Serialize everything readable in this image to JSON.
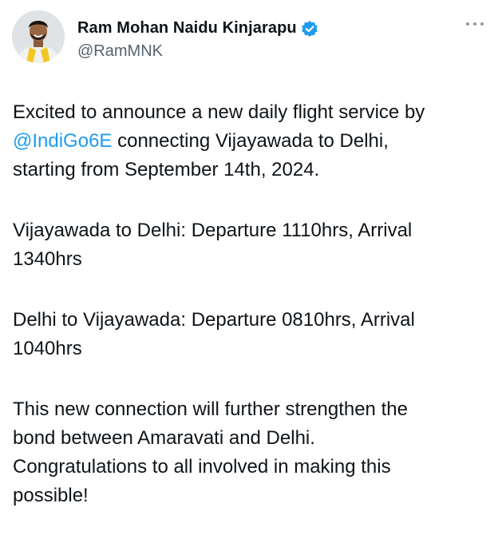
{
  "author": {
    "display_name": "Ram Mohan Naidu Kinjarapu",
    "handle": "@RamMNK",
    "verified": true,
    "avatar_icon": "profile-photo"
  },
  "menu": {
    "icon": "more-options-icon"
  },
  "tweet": {
    "p1_line1": "Excited to announce a new daily flight service by",
    "p1_mention": "@IndiGo6E",
    "p1_line2_rest": " connecting Vijayawada to Delhi,",
    "p1_line3": "starting from September 14th, 2024.",
    "p2_line1": "Vijayawada to Delhi: Departure 1110hrs, Arrival",
    "p2_line2": "1340hrs",
    "p3_line1": "Delhi to Vijayawada: Departure 0810hrs, Arrival",
    "p3_line2": "1040hrs",
    "p4_line1": "This new connection will further strengthen the",
    "p4_line2": "bond between Amaravati and Delhi.",
    "p4_line3": "Congratulations to all involved in making this",
    "p4_line4": "possible!"
  },
  "colors": {
    "text": "#0f1419",
    "secondary": "#536471",
    "link": "#1d9bf0",
    "verified_badge": "#1d9bf0"
  }
}
